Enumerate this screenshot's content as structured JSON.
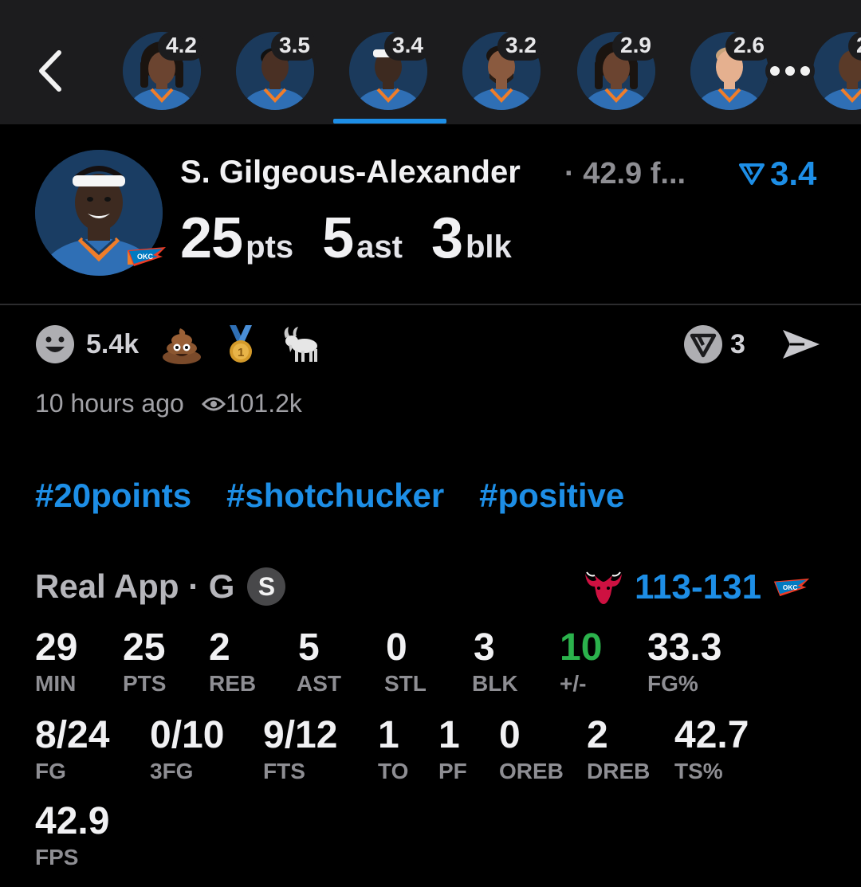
{
  "header_strip": {
    "players": [
      {
        "rating": "4.2",
        "skin": "#6b4430",
        "hair": "#1a1410"
      },
      {
        "rating": "3.5",
        "skin": "#4a3024",
        "hair": "#111"
      },
      {
        "rating": "3.4",
        "skin": "#3d2a20",
        "hair": "#111",
        "selected": true
      },
      {
        "rating": "3.2",
        "skin": "#8a5a3f",
        "hair": "#1a1410"
      },
      {
        "rating": "2.9",
        "skin": "#6b4430",
        "hair": "#1a1410"
      },
      {
        "rating": "2.6",
        "skin": "#e5b08f",
        "hair": "#c8a27a"
      },
      {
        "rating": "2",
        "skin": "#5a3a28",
        "hair": "#111"
      }
    ]
  },
  "player": {
    "name": "S. Gilgeous-Alexander",
    "fps_truncated": "· 42.9 f...",
    "rating": "3.4",
    "headline": [
      {
        "value": "25",
        "unit": "pts"
      },
      {
        "value": "5",
        "unit": "ast"
      },
      {
        "value": "3",
        "unit": "blk"
      }
    ]
  },
  "reactions": {
    "smile_count": "5.4k",
    "icons": [
      "smile-icon",
      "poop-emoji-icon",
      "medal-icon",
      "goat-icon"
    ],
    "rating_count": "3"
  },
  "meta": {
    "posted": "10 hours ago",
    "views": "101.2k"
  },
  "hashtags": [
    "#20points",
    "#shotchucker",
    "#positive"
  ],
  "game": {
    "source": "Real App · G",
    "badge": "S",
    "score": "113-131",
    "team_colors": {
      "bulls": "#ce1141",
      "okc": "#007ac1",
      "okc_accent": "#ef3b24"
    }
  },
  "stats": [
    {
      "value": "29",
      "label": "MIN"
    },
    {
      "value": "25",
      "label": "PTS"
    },
    {
      "value": "2",
      "label": "REB"
    },
    {
      "value": "5",
      "label": "AST"
    },
    {
      "value": "0",
      "label": "STL"
    },
    {
      "value": "3",
      "label": "BLK"
    },
    {
      "value": "10",
      "label": "+/-",
      "positive": true
    },
    {
      "value": "33.3",
      "label": "FG%"
    },
    {
      "value": "8/24",
      "label": "FG"
    },
    {
      "value": "0/10",
      "label": "3FG"
    },
    {
      "value": "9/12",
      "label": "FTS"
    },
    {
      "value": "1",
      "label": "TO"
    },
    {
      "value": "1",
      "label": "PF"
    },
    {
      "value": "0",
      "label": "OREB"
    },
    {
      "value": "2",
      "label": "DREB"
    },
    {
      "value": "42.7",
      "label": "TS%"
    },
    {
      "value": "42.9",
      "label": "FPS"
    }
  ],
  "colors": {
    "accent": "#1d8ee6",
    "positive": "#2bb24c",
    "background": "#000000",
    "topbar": "#1c1c1e"
  }
}
